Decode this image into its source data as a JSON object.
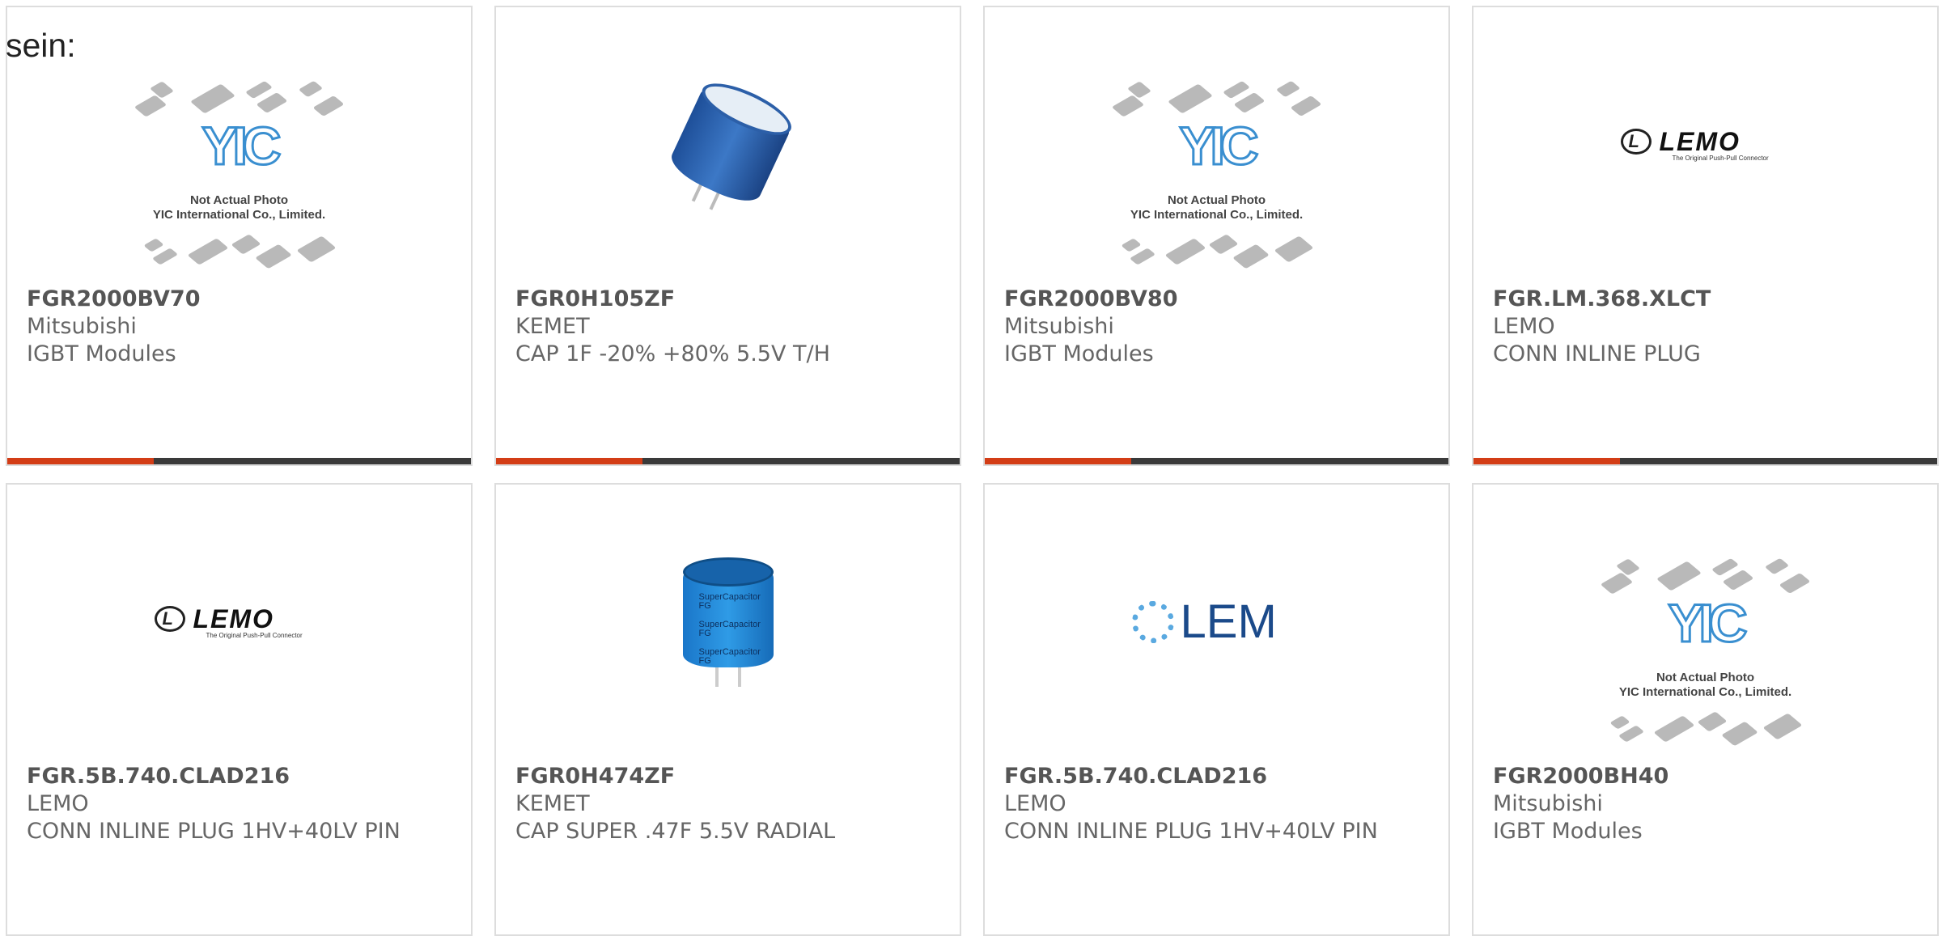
{
  "intro_text": "sein:",
  "brand": {
    "accent_color": "#d33d16",
    "bar_color": "#3a3a3a"
  },
  "yic_placeholder": {
    "logo_text": "YIC",
    "note_line1": "Not Actual Photo",
    "note_line2": "YIC International Co., Limited."
  },
  "logos": {
    "lemo_word": "LEMO",
    "lemo_tagline": "The Original Push-Pull Connector",
    "lem_word": "LEM"
  },
  "products": [
    {
      "part": "FGR2000BV70",
      "manufacturer": "Mitsubishi",
      "description": "IGBT Modules",
      "image": "yic-placeholder"
    },
    {
      "part": "FGR0H105ZF",
      "manufacturer": "KEMET",
      "description": "CAP 1F -20% +80% 5.5V T/H",
      "image": "blue-capacitor"
    },
    {
      "part": "FGR2000BV80",
      "manufacturer": "Mitsubishi",
      "description": "IGBT Modules",
      "image": "yic-placeholder"
    },
    {
      "part": "FGR.LM.368.XLCT",
      "manufacturer": "LEMO",
      "description": "CONN INLINE PLUG",
      "image": "lemo-logo"
    },
    {
      "part": "FGR.5B.740.CLAD216",
      "manufacturer": "LEMO",
      "description": "CONN INLINE PLUG 1HV+40LV PIN",
      "image": "lemo-logo"
    },
    {
      "part": "FGR0H474ZF",
      "manufacturer": "KEMET",
      "description": "CAP SUPER .47F 5.5V RADIAL",
      "image": "supercapacitor",
      "image_text": "SuperCapacitor FG"
    },
    {
      "part": "FGR.5B.740.CLAD216",
      "manufacturer": "LEMO",
      "description": "CONN INLINE PLUG 1HV+40LV PIN",
      "image": "lem-logo"
    },
    {
      "part": "FGR2000BH40",
      "manufacturer": "Mitsubishi",
      "description": "IGBT Modules",
      "image": "yic-placeholder"
    }
  ]
}
